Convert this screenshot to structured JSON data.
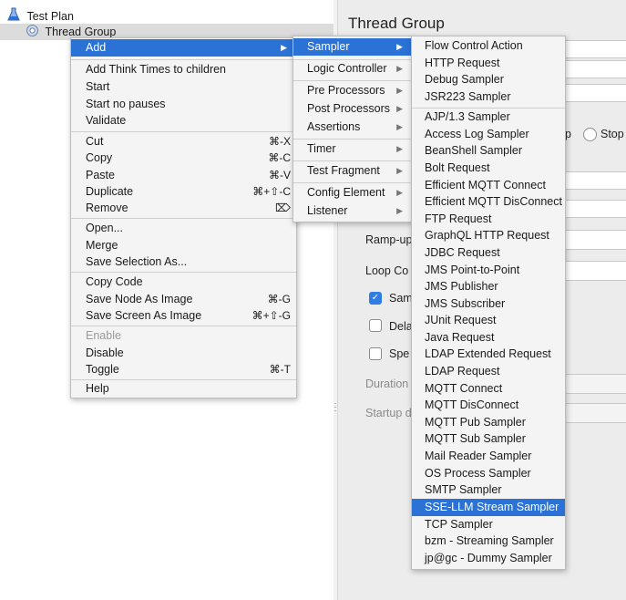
{
  "tree": {
    "items": [
      {
        "label": "Test Plan",
        "icon": "test-plan-flask-icon"
      },
      {
        "label": "Thread Group",
        "icon": "thread-group-gear-icon"
      }
    ]
  },
  "editor": {
    "title": "Thread Group",
    "radio_fragment": "p",
    "radio_stop_label": "Stop",
    "ramp_up_label": "Ramp-up",
    "loop_count_label": "Loop Co",
    "same_user_label": "Sam",
    "delay_label": "Dela",
    "specify_label": "Spe",
    "duration_label": "Duration",
    "startup_label": "Startup d",
    "same_user_checked": true,
    "delay_checked": false,
    "specify_checked": false
  },
  "context_menu": {
    "items": [
      {
        "label": "Add",
        "submenu": true,
        "highlighted": true
      },
      {
        "label": "Add Think Times to children"
      },
      {
        "label": "Start"
      },
      {
        "label": "Start no pauses"
      },
      {
        "label": "Validate"
      },
      {
        "label": "Cut",
        "shortcut": "⌘-X"
      },
      {
        "label": "Copy",
        "shortcut": "⌘-C"
      },
      {
        "label": "Paste",
        "shortcut": "⌘-V"
      },
      {
        "label": "Duplicate",
        "shortcut": "⌘+⇧-C"
      },
      {
        "label": "Remove",
        "shortcut": "⌦"
      },
      {
        "label": "Open..."
      },
      {
        "label": "Merge"
      },
      {
        "label": "Save Selection As..."
      },
      {
        "label": "Copy Code"
      },
      {
        "label": "Save Node As Image",
        "shortcut": "⌘-G"
      },
      {
        "label": "Save Screen As Image",
        "shortcut": "⌘+⇧-G"
      },
      {
        "label": "Enable",
        "disabled": true
      },
      {
        "label": "Disable"
      },
      {
        "label": "Toggle",
        "shortcut": "⌘-T"
      },
      {
        "label": "Help"
      }
    ]
  },
  "add_submenu": {
    "items": [
      {
        "label": "Sampler",
        "highlighted": true
      },
      {
        "label": "Logic Controller"
      },
      {
        "label": "Pre Processors"
      },
      {
        "label": "Post Processors"
      },
      {
        "label": "Assertions"
      },
      {
        "label": "Timer"
      },
      {
        "label": "Test Fragment"
      },
      {
        "label": "Config Element"
      },
      {
        "label": "Listener"
      }
    ]
  },
  "sampler_submenu": {
    "items": [
      {
        "label": "Flow Control Action"
      },
      {
        "label": "HTTP Request"
      },
      {
        "label": "Debug Sampler"
      },
      {
        "label": "JSR223 Sampler"
      },
      {
        "label": "AJP/1.3 Sampler"
      },
      {
        "label": "Access Log Sampler"
      },
      {
        "label": "BeanShell Sampler"
      },
      {
        "label": "Bolt Request"
      },
      {
        "label": "Efficient MQTT Connect"
      },
      {
        "label": "Efficient MQTT DisConnect"
      },
      {
        "label": "FTP Request"
      },
      {
        "label": "GraphQL HTTP Request"
      },
      {
        "label": "JDBC Request"
      },
      {
        "label": "JMS Point-to-Point"
      },
      {
        "label": "JMS Publisher"
      },
      {
        "label": "JMS Subscriber"
      },
      {
        "label": "JUnit Request"
      },
      {
        "label": "Java Request"
      },
      {
        "label": "LDAP Extended Request"
      },
      {
        "label": "LDAP Request"
      },
      {
        "label": "MQTT Connect"
      },
      {
        "label": "MQTT DisConnect"
      },
      {
        "label": "MQTT Pub Sampler"
      },
      {
        "label": "MQTT Sub Sampler"
      },
      {
        "label": "Mail Reader Sampler"
      },
      {
        "label": "OS Process Sampler"
      },
      {
        "label": "SMTP Sampler"
      },
      {
        "label": "SSE-LLM Stream Sampler",
        "highlighted": true
      },
      {
        "label": "TCP Sampler"
      },
      {
        "label": "bzm - Streaming Sampler"
      },
      {
        "label": "jp@gc - Dummy Sampler"
      }
    ]
  },
  "colors": {
    "highlight": "#2b72d6",
    "menu_bg": "#f4f4f4",
    "panel_bg": "#ececec",
    "checkbox_on": "#2f7ce4"
  }
}
